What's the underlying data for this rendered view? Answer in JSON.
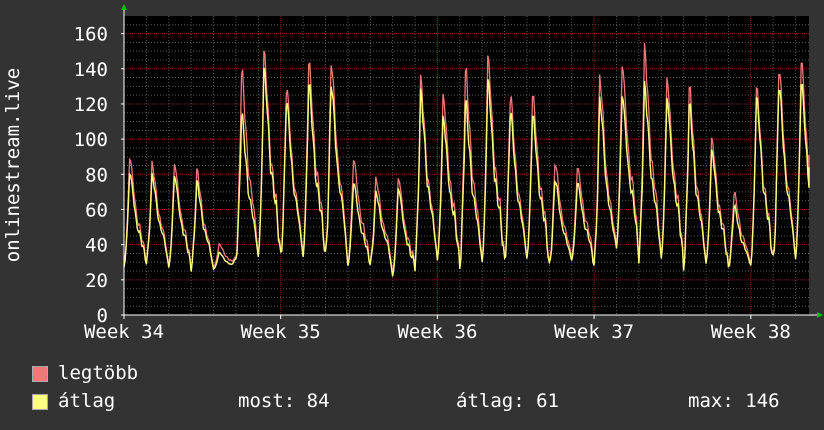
{
  "colors": {
    "background": "#333333",
    "plot_bg": "#000000",
    "grid_major": "#8b1a1a",
    "grid_minor": "#5a5a5a",
    "max_series": "#f07878",
    "avg_series": "#ffff80",
    "axis_arrow": "#00c000"
  },
  "legend": {
    "max_label": "legtöbb",
    "avg_label": "átlag"
  },
  "stats": {
    "now": "most: 84",
    "avg": "átlag: 61",
    "max": "max: 146"
  },
  "chart_data": {
    "type": "area",
    "title": "",
    "ylabel": "onlinestream.live",
    "xlabel": "",
    "ylim": [
      0,
      170
    ],
    "yticks": [
      "0",
      "20",
      "40",
      "60",
      "80",
      "100",
      "120",
      "140",
      "160"
    ],
    "yticks_values": [
      0,
      20,
      40,
      60,
      80,
      100,
      120,
      140,
      160
    ],
    "xticks": [
      "Week 34",
      "Week 35",
      "Week 36",
      "Week 37",
      "Week 38"
    ],
    "xticks_pos": [
      0,
      7,
      14,
      21,
      28
    ],
    "x_range": [
      0,
      30.6
    ],
    "grid": true,
    "legend_position": "bottom-left",
    "series": [
      {
        "name": "legtöbb",
        "style": "filled-area",
        "daily_peaks": [
          93,
          89,
          89,
          85,
          41,
          144,
          156,
          135,
          150,
          150,
          92,
          80,
          81,
          139,
          130,
          145,
          153,
          130,
          130,
          90,
          87,
          141,
          148,
          157,
          140,
          134,
          104,
          72,
          135,
          147,
          151,
          152,
          140
        ],
        "daily_troughs": [
          28,
          31,
          28,
          27,
          27,
          33,
          34,
          33,
          35,
          34,
          29,
          30,
          24,
          30,
          32,
          29,
          31,
          31,
          33,
          29,
          33,
          29,
          40,
          34,
          33,
          29,
          30,
          28,
          29,
          31,
          33,
          31,
          28
        ],
        "last": 91
      },
      {
        "name": "átlag",
        "style": "line",
        "daily_peaks": [
          84,
          82,
          82,
          78,
          36,
          118,
          146,
          127,
          137,
          137,
          78,
          72,
          75,
          131,
          117,
          126,
          139,
          120,
          118,
          80,
          78,
          128,
          130,
          135,
          128,
          124,
          97,
          64,
          129,
          137,
          138,
          137,
          127
        ],
        "daily_troughs": [
          27,
          30,
          27,
          27,
          26,
          32,
          33,
          32,
          33,
          33,
          28,
          29,
          22,
          29,
          31,
          28,
          30,
          30,
          32,
          28,
          31,
          28,
          38,
          33,
          32,
          28,
          29,
          27,
          28,
          30,
          32,
          30,
          27
        ],
        "last": 84
      }
    ]
  }
}
